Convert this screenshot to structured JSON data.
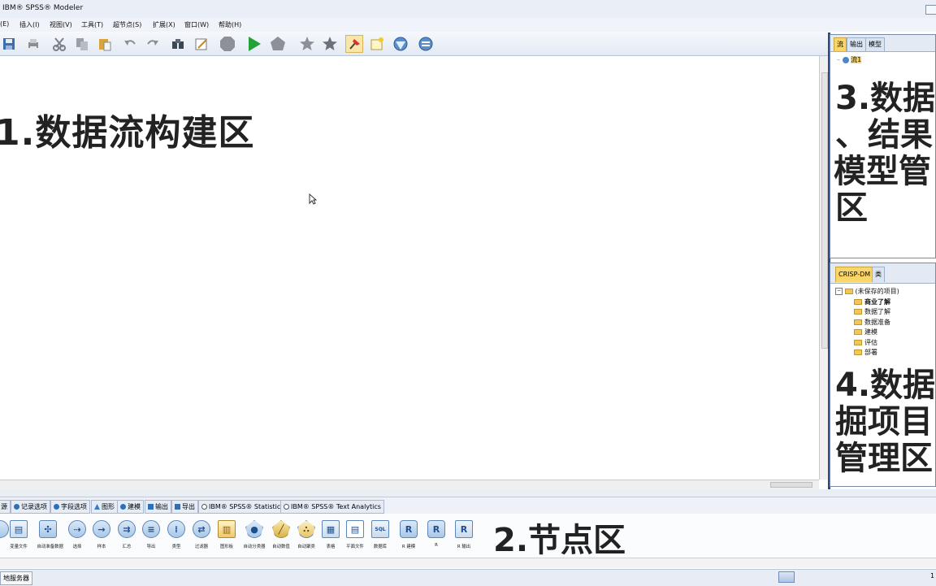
{
  "window": {
    "title": "IBM® SPSS® Modeler"
  },
  "menu": [
    "(E)",
    "插入(I)",
    "视图(V)",
    "工具(T)",
    "超节点(S)",
    "扩展(X)",
    "窗口(W)",
    "帮助(H)"
  ],
  "toolbar": {
    "icons": [
      "save-icon",
      "print-icon",
      "cut-icon",
      "copy-icon",
      "paste-icon",
      "undo-icon",
      "redo-icon",
      "find-icon",
      "edit-icon",
      "stop-icon",
      "run-icon",
      "supernode-icon",
      "star-icon",
      "star-filled-icon",
      "pin-icon",
      "new-annotation-icon",
      "model-icon",
      "globe-icon"
    ]
  },
  "canvas": {
    "label": "1.数据流构建区"
  },
  "right_top": {
    "tabs": [
      "流",
      "输出",
      "模型"
    ],
    "tree_item": "流1",
    "label_lines": [
      "3.数据",
      "、结果",
      "模型管",
      "区"
    ]
  },
  "right_bottom": {
    "tabs": [
      "CRISP-DM",
      "类"
    ],
    "root": "(未保存的项目)",
    "items": [
      "商业了解",
      "数据了解",
      "数据准备",
      "建模",
      "评估",
      "部署"
    ],
    "label_lines": [
      "4.数据",
      "掘项目",
      "管理区"
    ]
  },
  "palette_tabs": [
    "源",
    "记录选项",
    "字段选项",
    "图形",
    "建模",
    "输出",
    "导出",
    "IBM® SPSS® Statistics",
    "IBM® SPSS® Text Analytics"
  ],
  "palette_nodes": [
    {
      "icon": "node-icon",
      "label": ""
    },
    {
      "icon": "file-icon",
      "label": "变量文件"
    },
    {
      "icon": "auto-data-icon",
      "label": "自动准备数据"
    },
    {
      "icon": "select-icon",
      "label": "选择"
    },
    {
      "icon": "sample-icon",
      "label": "样本"
    },
    {
      "icon": "aggregate-icon",
      "label": "汇总"
    },
    {
      "icon": "merge-icon",
      "label": "导出"
    },
    {
      "icon": "type-icon",
      "label": "类型"
    },
    {
      "icon": "filter-icon",
      "label": "过滤器"
    },
    {
      "icon": "graph-icon",
      "label": "图形板"
    },
    {
      "icon": "auto-classifier-icon",
      "label": "自动分类器"
    },
    {
      "icon": "auto-numeric-icon",
      "label": "自动数值"
    },
    {
      "icon": "auto-cluster-icon",
      "label": "自动聚类"
    },
    {
      "icon": "table-icon",
      "label": "表格"
    },
    {
      "icon": "flat-file-icon",
      "label": "平面文件"
    },
    {
      "icon": "database-icon",
      "label": "数据库"
    },
    {
      "icon": "r-build-icon",
      "label": "R 建模"
    },
    {
      "icon": "r-icon",
      "label": "R"
    },
    {
      "icon": "r-output-icon",
      "label": "R 输出"
    }
  ],
  "palette_label": "2.节点区",
  "status": {
    "server": "地服务器",
    "page": "1"
  }
}
